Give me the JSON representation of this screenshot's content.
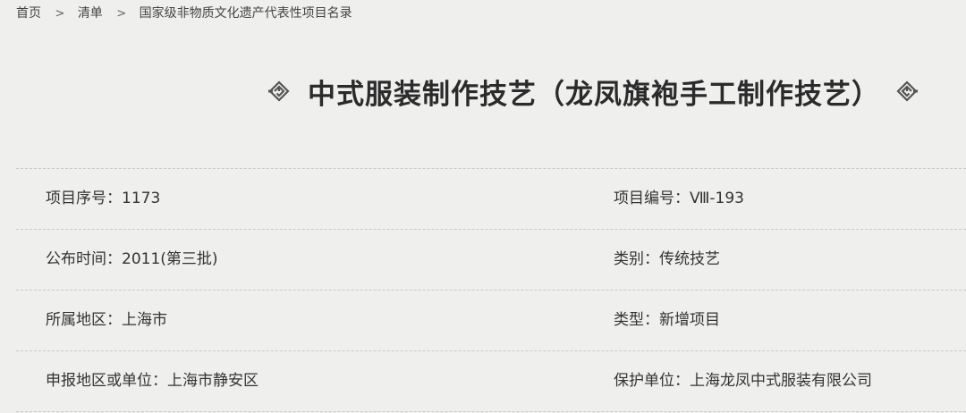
{
  "breadcrumb": {
    "home": "首页",
    "list": "清单",
    "current": "国家级非物质文化遗产代表性项目名录",
    "separator": ">"
  },
  "title": {
    "text": "中式服装制作技艺（龙凤旗袍手工制作技艺）",
    "left_ornament": "knot-ornament-icon",
    "right_ornament": "knot-ornament-icon"
  },
  "rows": [
    {
      "left": "项目序号：1173",
      "right": "项目编号：Ⅷ-193"
    },
    {
      "left": "公布时间：2011(第三批)",
      "right": "类别：传统技艺"
    },
    {
      "left": "所属地区：上海市",
      "right": "类型：新增项目"
    },
    {
      "left": "申报地区或单位：上海市静安区",
      "right": "保护单位：上海龙凤中式服装有限公司"
    }
  ],
  "colors": {
    "background": "#efefee",
    "text": "#333333",
    "divider": "#c9c9c9",
    "ornament": "#555555"
  }
}
